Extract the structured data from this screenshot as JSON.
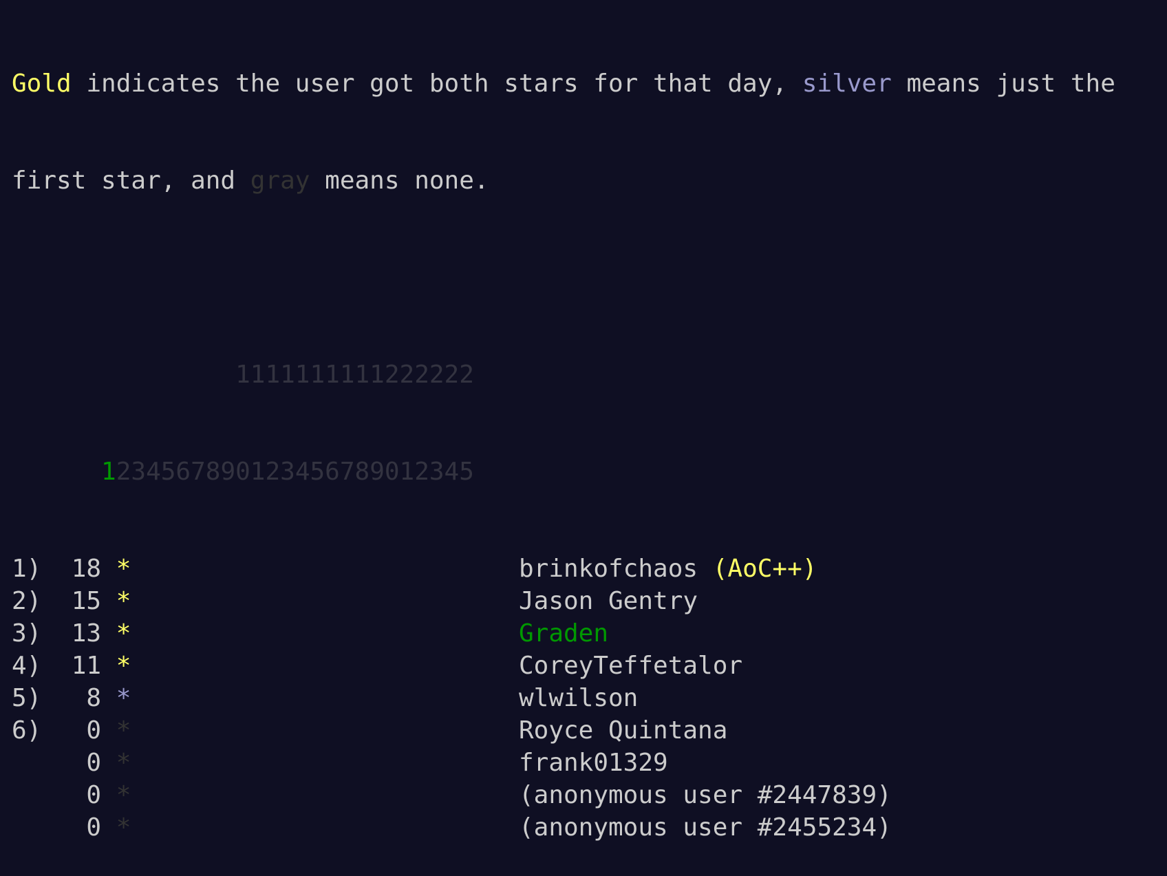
{
  "intro": {
    "gold_word": "Gold",
    "line1_rest": " indicates the user got both stars for that day, ",
    "silver_word": "silver",
    "line1_end": " means just the",
    "line2_start": "first star, and ",
    "gray_word": "gray",
    "line2_end": " means none."
  },
  "header": {
    "tens_row": "1111111111222222",
    "ones_row": "1234567890123456789012345",
    "active_day": "1"
  },
  "colors": {
    "gold": "#ffff66",
    "silver": "#9999cc",
    "gray": "#333333",
    "green": "#009900",
    "background": "#0f0f23",
    "text": "#cccccc"
  },
  "leaderboard": [
    {
      "rank": "1)",
      "score": "18",
      "star": "*",
      "star_level": "gold",
      "name": "brinkofchaos",
      "badge": "(AoC++)"
    },
    {
      "rank": "2)",
      "score": "15",
      "star": "*",
      "star_level": "gold",
      "name": "Jason Gentry",
      "badge": ""
    },
    {
      "rank": "3)",
      "score": "13",
      "star": "*",
      "star_level": "gold",
      "name": "Graden",
      "badge": ""
    },
    {
      "rank": "4)",
      "score": "11",
      "star": "*",
      "star_level": "gold",
      "name": "CoreyTeffetalor",
      "badge": ""
    },
    {
      "rank": "5)",
      "score": "8",
      "star": "*",
      "star_level": "silver",
      "name": "wlwilson",
      "badge": ""
    },
    {
      "rank": "6)",
      "score": "0",
      "star": "*",
      "star_level": "gray",
      "name": "Royce Quintana",
      "badge": ""
    },
    {
      "rank": "",
      "score": "0",
      "star": "*",
      "star_level": "gray",
      "name": "frank01329",
      "badge": ""
    },
    {
      "rank": "",
      "score": "0",
      "star": "*",
      "star_level": "gray",
      "name": "(anonymous user #2447839)",
      "badge": ""
    },
    {
      "rank": "",
      "score": "0",
      "star": "*",
      "star_level": "gray",
      "name": "(anonymous user #2455234)",
      "badge": ""
    }
  ]
}
